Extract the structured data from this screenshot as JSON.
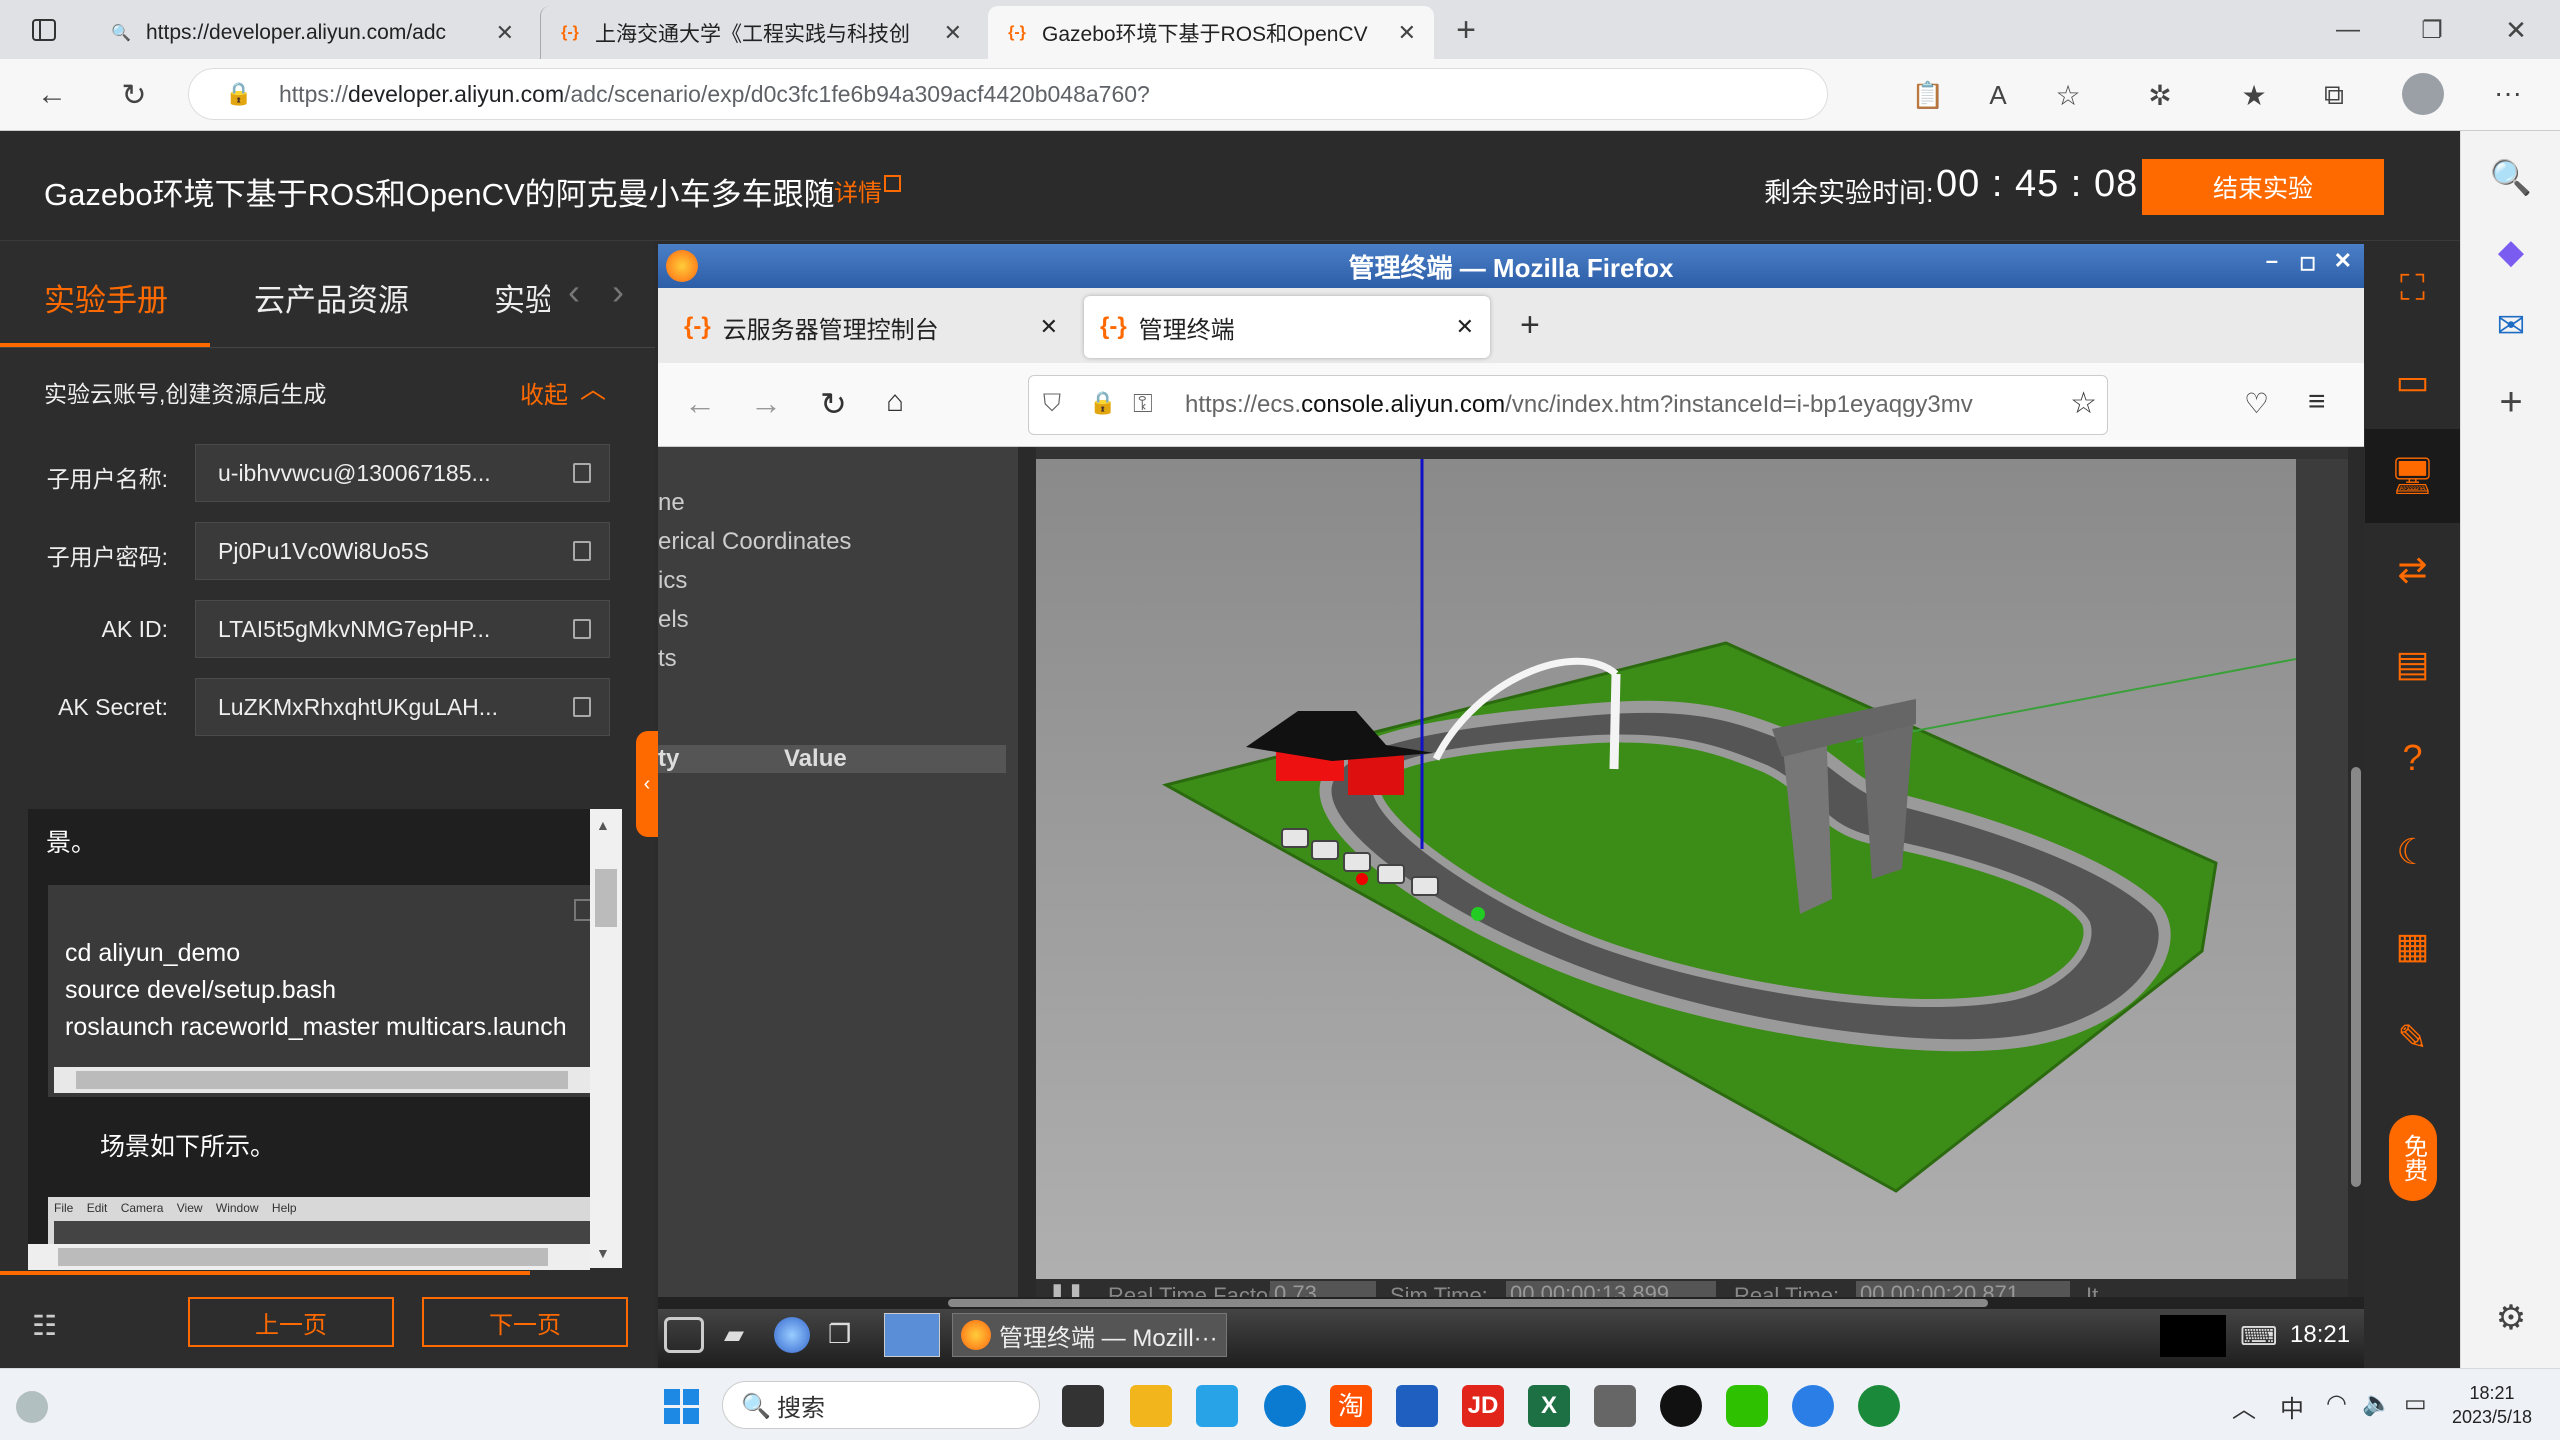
{
  "browser": {
    "tabs": [
      {
        "label": "https://developer.aliyun.com/adc"
      },
      {
        "label": "上海交通大学《工程实践与科技创"
      },
      {
        "label": "Gazebo环境下基于ROS和OpenCV"
      }
    ],
    "url_prefix": "https://",
    "url_host": "developer.aliyun.com",
    "url_path": "/adc/scenario/exp/d0c3fc1fe6b94a309acf4420b048a760?"
  },
  "header": {
    "title": "Gazebo环境下基于ROS和OpenCV的阿克曼小车多车跟随",
    "details": "详情",
    "timer_label": "剩余实验时间:",
    "timer_h": "00",
    "timer_m": "45",
    "timer_s": "08",
    "end_button": "结束实验"
  },
  "left": {
    "tabs": [
      "实验手册",
      "云产品资源",
      "实验"
    ],
    "account_note": "实验云账号,创建资源后生成",
    "collapse": "收起",
    "fields": [
      {
        "label": "子用户名称:",
        "value": "u-ibhvvwcu@130067185..."
      },
      {
        "label": "子用户密码:",
        "value": "Pj0Pu1Vc0Wi8Uo5S"
      },
      {
        "label": "AK ID:",
        "value": "LTAI5t5gMkvNMG7epHP..."
      },
      {
        "label": "AK Secret:",
        "value": "LuZKMxRhxqhtUKguLAH..."
      }
    ],
    "content_heading": "景。",
    "code": [
      "cd aliyun_demo",
      "source devel/setup.bash",
      "roslaunch raceworld_master multicars.launch"
    ],
    "scene_text": "场景如下所示。",
    "thumb_menu": [
      "File",
      "Edit",
      "Camera",
      "View",
      "Window",
      "Help"
    ],
    "prev": "上一页",
    "next": "下一页"
  },
  "vnc": {
    "window_title": "管理终端 — Mozilla Firefox",
    "tabs": [
      "云服务器管理控制台",
      "管理终端"
    ],
    "url_prefix": "https://ecs.",
    "url_host": "console.aliyun.com",
    "url_path": "/vnc/index.htm?instanceId=i-bp1eyaqgy3mv",
    "panel_items": [
      "ne",
      "erical Coordinates",
      "ics",
      "els",
      "ts"
    ],
    "prop_col": "ty",
    "value_col": "Value",
    "status": {
      "rtf_label": "Real Time Factor:",
      "rtf": "0.73",
      "sim_label": "Sim Time:",
      "sim": "00 00:00:13.899",
      "real_label": "Real Time:",
      "real": "00 00:00:20.871",
      "it": "It"
    },
    "taskbar_window": "管理终端 — Mozill···",
    "clock": "18:21"
  },
  "windows": {
    "search": "搜索",
    "ime": "中",
    "time": "18:21",
    "date": "2023/5/18"
  },
  "colors": {
    "accent": "#ff6a00",
    "grass": "#3c8c18",
    "track": "#555555"
  }
}
